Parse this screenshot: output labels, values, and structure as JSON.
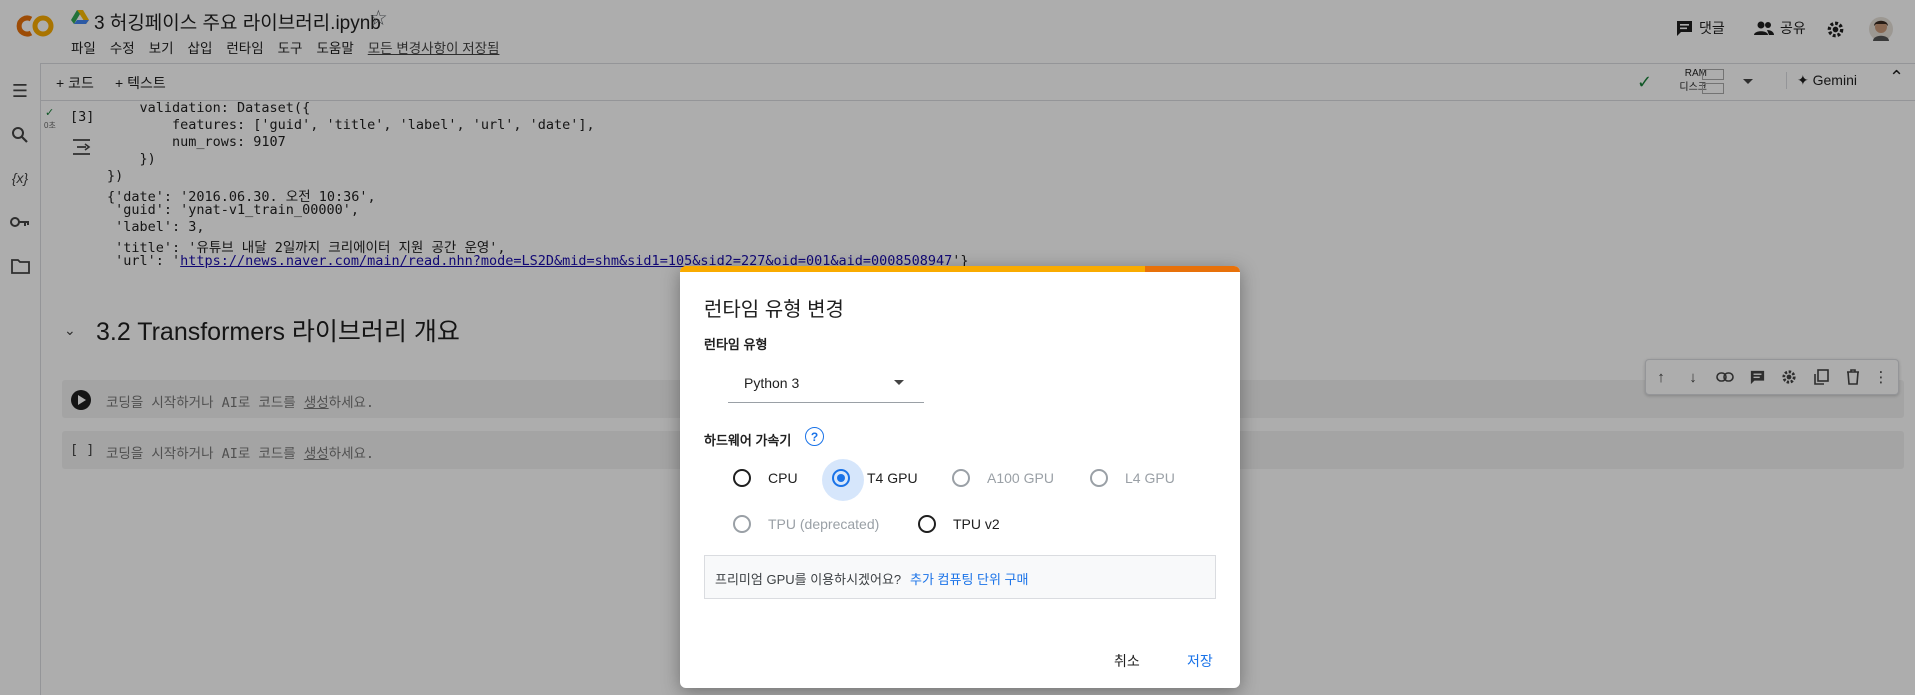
{
  "header": {
    "title": "3 허깅페이스 주요 라이브러리.ipynb",
    "menu": [
      "파일",
      "수정",
      "보기",
      "삽입",
      "런타임",
      "도구",
      "도움말"
    ],
    "saved_status": "모든 변경사항이 저장됨",
    "comment_label": "댓글",
    "share_label": "공유"
  },
  "toolbar": {
    "add_code": "+ 코드",
    "add_text": "+ 텍스트",
    "ram_label": "RAM",
    "disk_label": "디스크",
    "gemini_label": "Gemini"
  },
  "cell_output": {
    "exec_count": "[3]",
    "exec_time": "0초",
    "lines": [
      "    validation: Dataset({",
      "        features: ['guid', 'title', 'label', 'url', 'date'],",
      "        num_rows: 9107",
      "    })",
      "})",
      "{'date': '2016.06.30. 오전 10:36',",
      " 'guid': 'ynat-v1_train_00000',",
      " 'label': 3,",
      " 'title': '유튜브 내달 2일까지 크리에이터 지원 공간 운영',"
    ],
    "url_prefix": " 'url': '",
    "url": "https://news.naver.com/main/read.nhn?mode=LS2D&mid=shm&sid1=105&sid2=227&oid=001&aid=0008508947",
    "url_suffix": "'}"
  },
  "section": {
    "heading": "3.2 Transformers 라이브러리 개요"
  },
  "cells": [
    {
      "prompt": "",
      "placeholder_prefix": "코딩을 시작하거나 AI로 코드를 ",
      "placeholder_link": "생성",
      "placeholder_suffix": "하세요."
    },
    {
      "prompt": "[ ]",
      "placeholder_prefix": "코딩을 시작하거나 AI로 코드를 ",
      "placeholder_link": "생성",
      "placeholder_suffix": "하세요."
    }
  ],
  "dialog": {
    "title": "런타임 유형 변경",
    "runtime_label": "런타임 유형",
    "runtime_value": "Python 3",
    "hw_label": "하드웨어 가속기",
    "options": [
      {
        "label": "CPU",
        "checked": false,
        "disabled": false
      },
      {
        "label": "T4 GPU",
        "checked": true,
        "disabled": false
      },
      {
        "label": "A100 GPU",
        "checked": false,
        "disabled": true
      },
      {
        "label": "L4 GPU",
        "checked": false,
        "disabled": true
      },
      {
        "label": "TPU (deprecated)",
        "checked": false,
        "disabled": true
      },
      {
        "label": "TPU v2",
        "checked": false,
        "disabled": false
      }
    ],
    "promo_text": "프리미엄 GPU를 이용하시겠어요?",
    "promo_link": "추가 컴퓨팅 단위 구매",
    "cancel_label": "취소",
    "save_label": "저장"
  },
  "colors": {
    "accent": "#1a73e8",
    "brand_orange": "#f9ab00",
    "brand_dark_orange": "#e8710a"
  }
}
